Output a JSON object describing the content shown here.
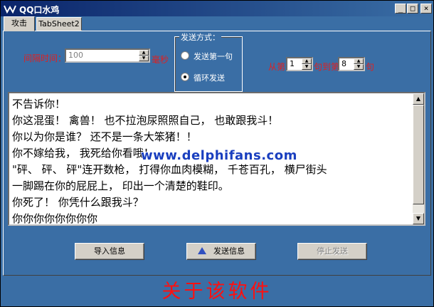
{
  "window": {
    "title": "QQ口水鸡",
    "controls": {
      "minimize": "_",
      "maximize": "□",
      "close": "×"
    },
    "title_bar_color": "#0a246a",
    "body_color": "#3a6ea5"
  },
  "tabs": [
    {
      "label": "攻击",
      "active": true
    },
    {
      "label": "TabSheet2",
      "active": false
    }
  ],
  "interval": {
    "label": "间隔时间：",
    "value": "100",
    "unit": "毫秒"
  },
  "send_mode": {
    "title": "发送方式：",
    "options": [
      {
        "label": "发送第一句",
        "selected": false
      },
      {
        "label": "循环发送",
        "selected": true
      }
    ]
  },
  "range": {
    "from_label": "从第",
    "from_value": "1",
    "to_label": "句到第",
    "to_value": "8",
    "suffix": "句"
  },
  "memo": {
    "lines": [
      "不告诉你！",
      "你这混蛋！ 禽兽！ 也不拉泡尿照照自己， 也敢跟我斗！",
      "你以为你是谁？ 还不是一条大笨猪！！",
      "你不嫁给我， 我死给你看哦！",
      "\"砰、 砰、 砰\"连开数枪， 打得你血肉模糊， 千苍百孔， 横尸街头",
      "一脚踢在你的屁屁上， 印出一个清楚的鞋印。",
      "你死了！ 你凭什么跟我斗？",
      "你你你你你你你你"
    ],
    "watermark": "www.delphifans.com"
  },
  "buttons": {
    "import": "导入信息",
    "send": "发送信息",
    "stop": "停止发送"
  },
  "footer": {
    "about": "关于该软件",
    "color": "#ff1010"
  }
}
